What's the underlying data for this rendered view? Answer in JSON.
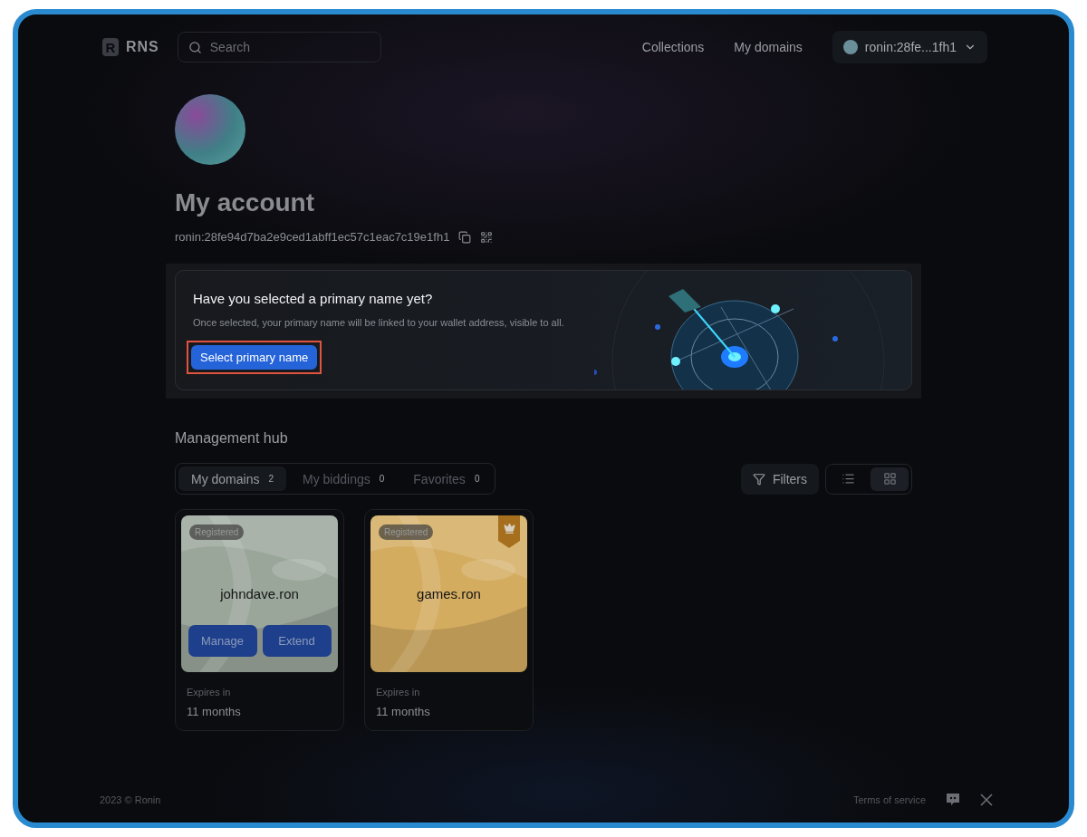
{
  "header": {
    "logo": {
      "letter": "R",
      "name": "RNS"
    },
    "search": {
      "placeholder": "Search"
    },
    "nav": [
      "Collections",
      "My domains"
    ],
    "account": {
      "label": "ronin:28fe...1fh1"
    }
  },
  "profile": {
    "title": "My account",
    "address": "ronin:28fe94d7ba2e9ced1abff1ec57c1eac7c19e1fh1"
  },
  "banner": {
    "title": "Have you selected a primary name yet?",
    "text": "Once selected, your primary name will be linked to your wallet address, visible to all.",
    "button": {
      "label": "Select primary name",
      "highlighted": true
    }
  },
  "hub": {
    "title": "Management hub",
    "tabs": [
      {
        "label": "My domains",
        "count": "2",
        "selected": true
      },
      {
        "label": "My biddings",
        "count": "0",
        "selected": false
      },
      {
        "label": "Favorites",
        "count": "0",
        "selected": false
      }
    ],
    "filters": "Filters",
    "views": [
      {
        "kind": "list",
        "selected": false
      },
      {
        "kind": "grid",
        "selected": true
      }
    ],
    "domains": [
      {
        "name": "johndave.ron",
        "status": "Registered",
        "color": "#9aa69a",
        "primary": false,
        "actions": [
          "Manage",
          "Extend"
        ],
        "expires_label": "Expires in",
        "expires": "11 months"
      },
      {
        "name": "games.ron",
        "status": "Registered",
        "color": "#d4ac60",
        "primary": true,
        "expires_label": "Expires in",
        "expires": "11 months"
      }
    ]
  },
  "footer": {
    "copyright": "2023 © Ronin",
    "links": [
      "Terms of service"
    ]
  }
}
